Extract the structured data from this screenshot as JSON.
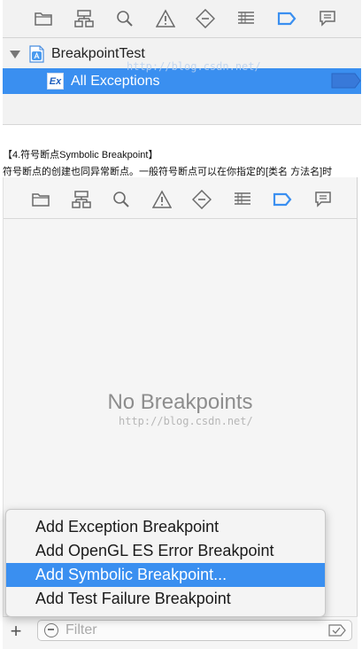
{
  "toolbar": {
    "icons": [
      "folder-icon",
      "hierarchy-icon",
      "search-icon",
      "warning-icon",
      "test-diamond-icon",
      "debug-list-icon",
      "breakpoint-navigator-icon",
      "report-bubble-icon"
    ],
    "active": "breakpoint-navigator-icon",
    "active_color": "#3a8ff0"
  },
  "panel1": {
    "project_name": "BreakpointTest",
    "exception_badge": "Ex",
    "breakpoint_label": "All Exceptions",
    "watermark": "http://blog.csdn.net/"
  },
  "caption": {
    "heading": "【4.符号断点Symbolic Breakpoint】",
    "text": "符号断点的创建也同异常断点。一般符号断点可以在你指定的[类名 方法名]时"
  },
  "panel2": {
    "empty_message": "No Breakpoints",
    "watermark": "http://blog.csdn.net/",
    "menu_items": [
      "Add Exception Breakpoint",
      "Add OpenGL ES Error Breakpoint",
      "Add Symbolic Breakpoint...",
      "Add Test Failure Breakpoint"
    ],
    "selected_menu_index": 2,
    "add_button": "+",
    "filter_placeholder": "Filter"
  }
}
